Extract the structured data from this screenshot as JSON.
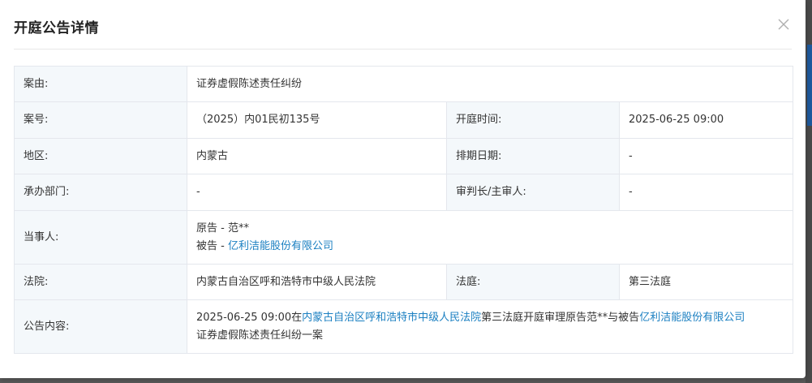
{
  "modal": {
    "title": "开庭公告详情",
    "close_label": "×"
  },
  "rows": {
    "case_cause": {
      "label": "案由:",
      "value": "证券虚假陈述责任纠纷"
    },
    "case_no": {
      "label": "案号:",
      "value": "（2025）内01民初135号"
    },
    "hearing_time": {
      "label": "开庭时间:",
      "value": "2025-06-25 09:00"
    },
    "region": {
      "label": "地区:",
      "value": "内蒙古"
    },
    "schedule_date": {
      "label": "排期日期:",
      "value": "-"
    },
    "department": {
      "label": "承办部门:",
      "value": "-"
    },
    "presiding_judge": {
      "label": "审判长/主审人:",
      "value": "-"
    },
    "parties": {
      "label": "当事人:",
      "plaintiff_prefix": "原告 - ",
      "plaintiff": "范**",
      "defendant_prefix": "被告 - ",
      "defendant": "亿利洁能股份有限公司"
    },
    "court": {
      "label": "法院:",
      "value": "内蒙古自治区呼和浩特市中级人民法院"
    },
    "courtroom": {
      "label": "法庭:",
      "value": "第三法庭"
    },
    "content": {
      "label": "公告内容:",
      "part1": "2025-06-25 09:00在",
      "court_link": "内蒙古自治区呼和浩特市中级人民法院",
      "part2": "第三法庭开庭审理原告范**与被告",
      "company_link": "亿利洁能股份有限公司",
      "part3": "证券虚假陈述责任纠纷一案"
    }
  },
  "colors": {
    "link": "#1a7fc1",
    "label_bg": "#f4f8fb",
    "border": "#e4e7ed",
    "text": "#333333"
  }
}
